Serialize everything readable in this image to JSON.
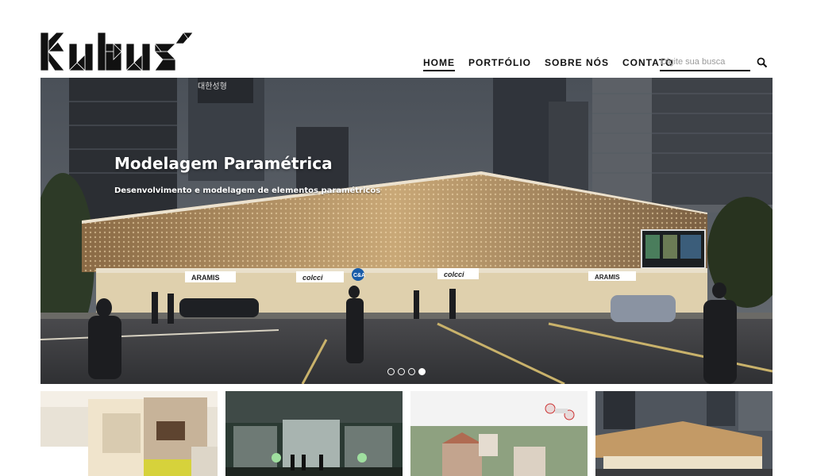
{
  "brand": {
    "logo_name": "kubus-logo"
  },
  "nav": {
    "items": [
      {
        "label": "HOME",
        "active": true
      },
      {
        "label": "PORTFÓLIO",
        "active": false
      },
      {
        "label": "SOBRE NÓS",
        "active": false
      },
      {
        "label": "CONTATO",
        "active": false
      }
    ]
  },
  "search": {
    "placeholder": "Digite sua busca",
    "icon": "search-icon"
  },
  "hero": {
    "title": "Modelagem Paramétrica",
    "subtitle": "Desenvolvimento e modelagem de elementos paramétricos",
    "slides": 4,
    "active_slide": 4,
    "signs": [
      "대한성형",
      "ARAMIS",
      "colcci",
      "C&A",
      "colcci",
      "ARAMIS"
    ]
  },
  "thumbnails": [
    {
      "name": "thumbnail-interior"
    },
    {
      "name": "thumbnail-fountain-night"
    },
    {
      "name": "thumbnail-drone-town"
    },
    {
      "name": "thumbnail-parametric-building"
    }
  ]
}
